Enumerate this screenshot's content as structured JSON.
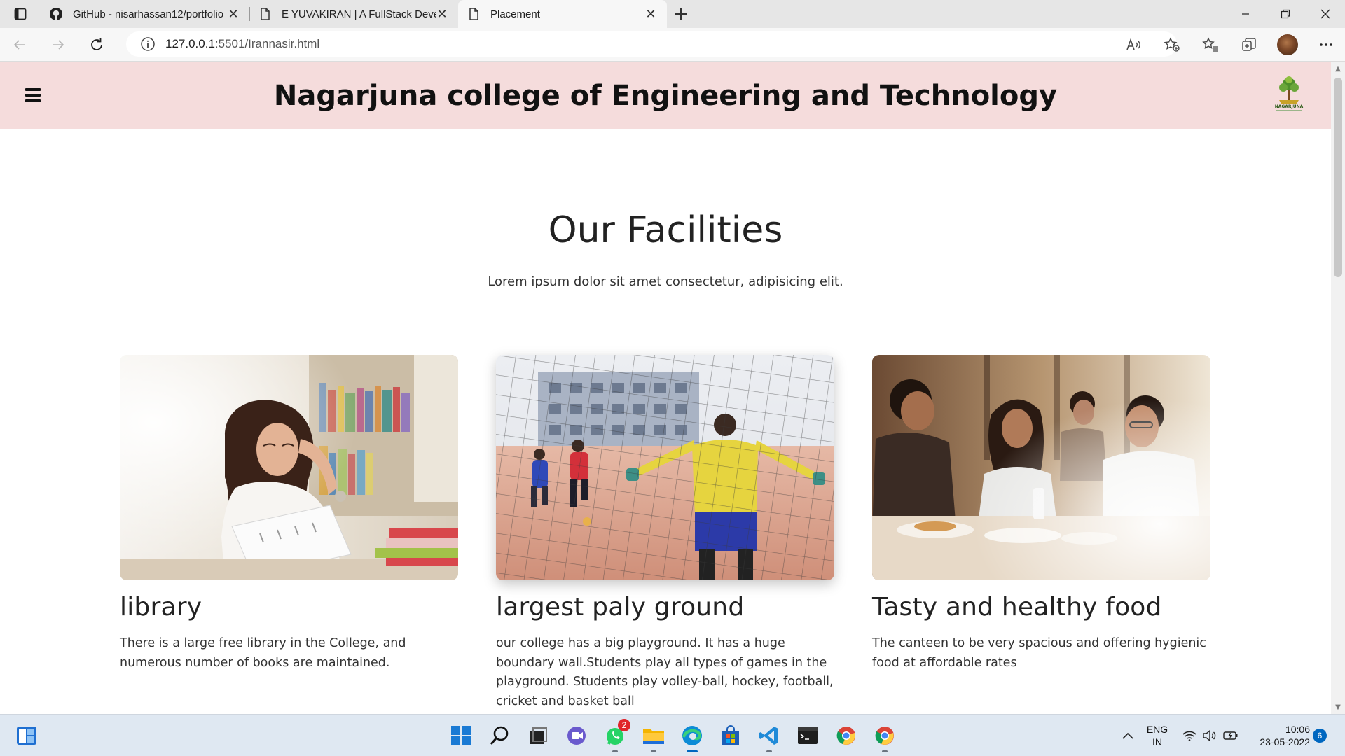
{
  "browser": {
    "tabs": [
      {
        "title": "GitHub - nisarhassan12/portfolio",
        "icon": "github-icon",
        "active": false
      },
      {
        "title": "E YUVAKIRAN | A FullStack Devel",
        "icon": "page-icon",
        "active": false
      },
      {
        "title": "Placement",
        "icon": "page-icon",
        "active": true
      }
    ],
    "new_tab": "+",
    "address": {
      "host": "127.0.0.1",
      "path": ":5501/Irannasir.html"
    }
  },
  "site": {
    "header_title": "Nagarjuna college of Engineering and Technology",
    "logo_text": "NAGARJUNA",
    "section_title": "Our Facilities",
    "section_subtitle": "Lorem ipsum dolor sit amet consectetur, adipisicing elit.",
    "cards": [
      {
        "title": "library",
        "text": "There is a large free library in the College, and numerous number of books are maintained."
      },
      {
        "title": "largest paly ground",
        "text": "our college has a big playground. It has a huge boundary wall.Students play all types of games in the playground. Students play volley-ball, hockey, football, cricket and basket ball"
      },
      {
        "title": "Tasty and healthy food",
        "text": "The canteen to be very spacious and offering hygienic food at affordable rates"
      }
    ]
  },
  "taskbar": {
    "whatsapp_badge": "2",
    "lang_line1": "ENG",
    "lang_line2": "IN",
    "time": "10:06",
    "date": "23-05-2022",
    "notifications": "6"
  },
  "colors": {
    "header_bg": "#f5dcdc",
    "taskbar_bg": "#dfe8f2",
    "accent": "#0067c0"
  }
}
